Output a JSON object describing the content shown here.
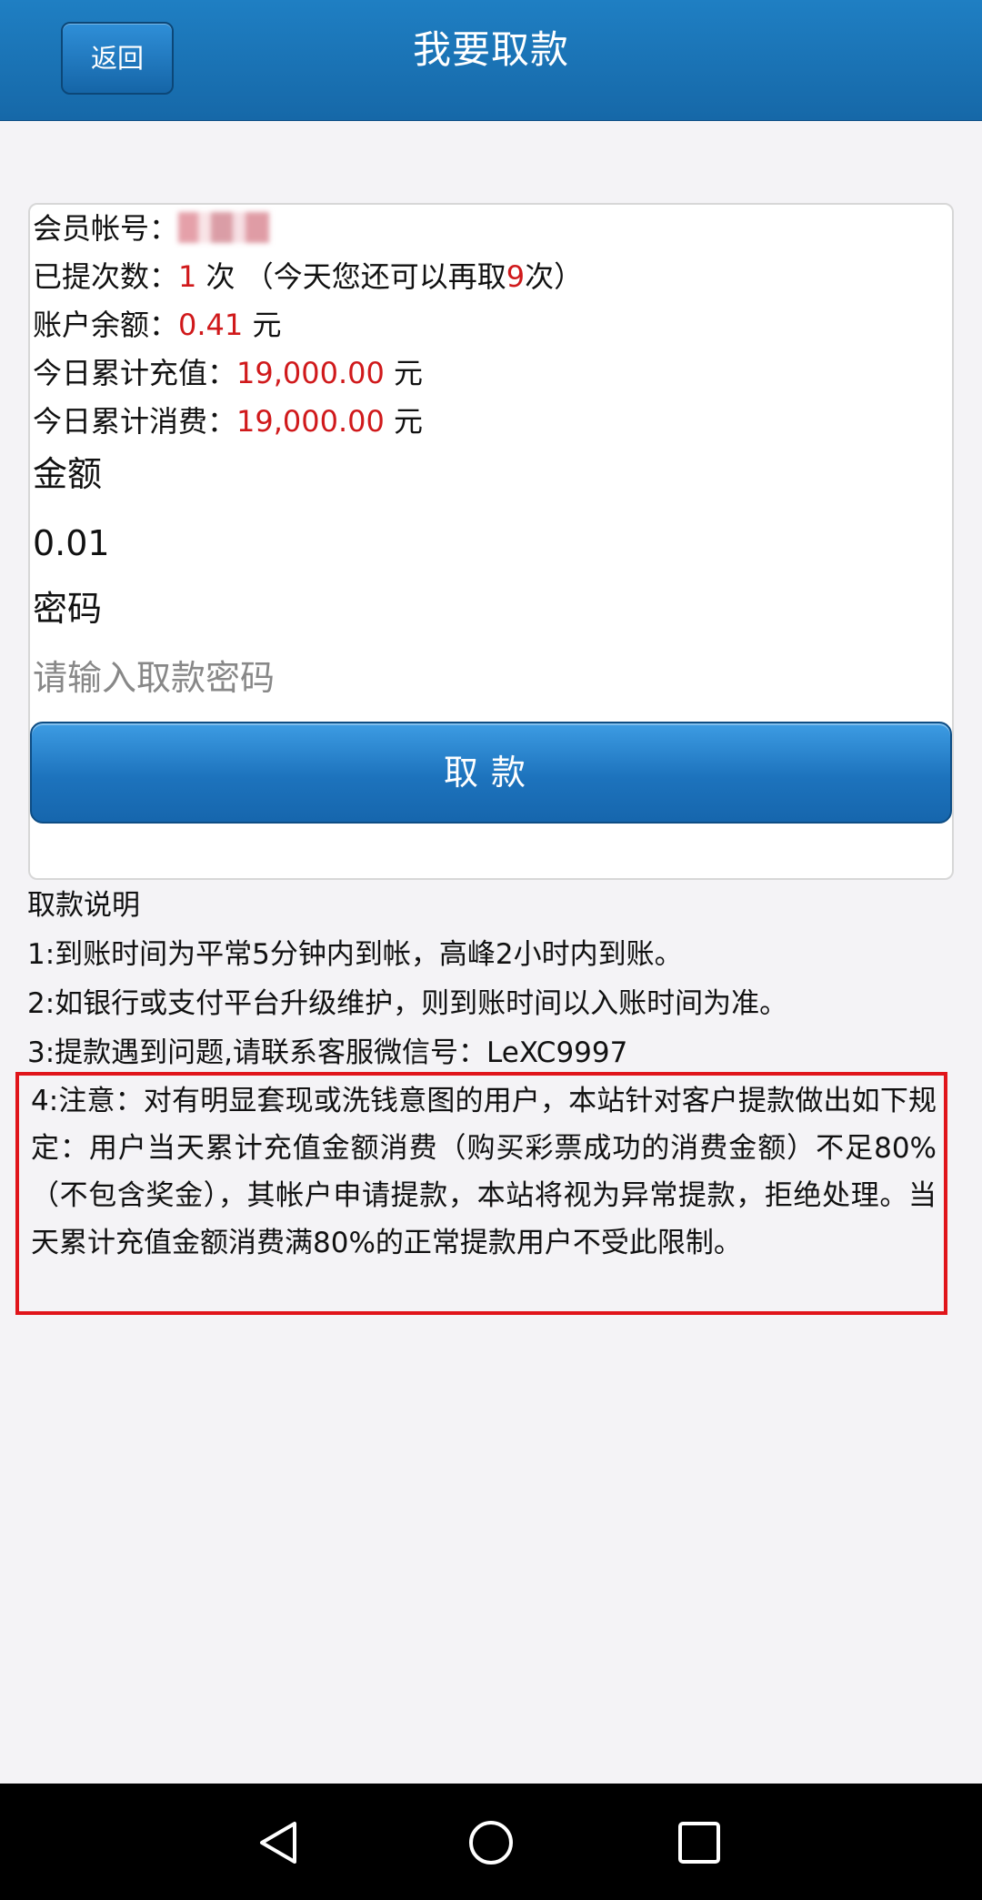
{
  "header": {
    "back_label": "返回",
    "title": "我要取款"
  },
  "account": {
    "member_label": "会员帐号：",
    "withdraw_count_label": "已提次数：",
    "withdraw_count_value": "1",
    "withdraw_count_unit": " 次 （今天您还可以再取",
    "remaining_count": "9",
    "remaining_suffix": "次）",
    "balance_label": "账户余额：",
    "balance_value": "0.41",
    "currency_unit": " 元",
    "recharge_label": "今日累计充值：",
    "recharge_value": "19,000.00",
    "spend_label": "今日累计消费：",
    "spend_value": "19,000.00"
  },
  "form": {
    "amount_label": "金额",
    "amount_value": "0.01",
    "password_label": "密码",
    "password_placeholder": "请输入取款密码",
    "submit_label": "取款"
  },
  "notes": {
    "title": "取款说明",
    "items": [
      "1:到账时间为平常5分钟内到帐，高峰2小时内到账。",
      "2:如银行或支付平台升级维护，则到账时间以入账时间为准。",
      "3:提款遇到问题,请联系客服微信号：LeXC9997",
      "4:注意：对有明显套现或洗钱意图的用户，本站针对客户提款做出如下规定：用户当天累计充值金额消费（购买彩票成功的消费金额）不足80%（不包含奖金），其帐户申请提款，本站将视为异常提款，拒绝处理。当天累计充值金额消费满80%的正常提款用户不受此限制。"
    ]
  },
  "colors": {
    "header_blue": "#1a73b8",
    "accent_red": "#d0191b",
    "highlight_border": "#e0141a"
  },
  "nav_icons": [
    "back-triangle-icon",
    "home-circle-icon",
    "recents-square-icon"
  ]
}
